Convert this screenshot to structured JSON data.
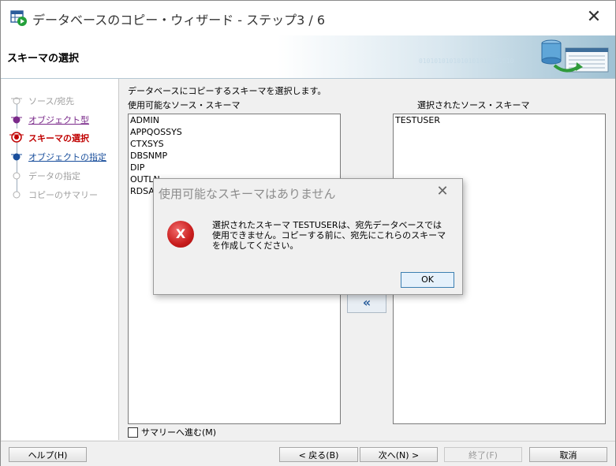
{
  "window": {
    "title": "データベースのコピー・ウィザード - ステップ3 / 6",
    "close_glyph": "✕"
  },
  "header": {
    "title": "スキーマの選択",
    "binary_text": "0101010101010101010101010"
  },
  "steps": [
    {
      "label": "ソース/宛先",
      "state": "disabled"
    },
    {
      "label": "オブジェクト型",
      "state": "visited"
    },
    {
      "label": "スキーマの選択",
      "state": "current"
    },
    {
      "label": "オブジェクトの指定",
      "state": "link"
    },
    {
      "label": "データの指定",
      "state": "disabled"
    },
    {
      "label": "コピーのサマリー",
      "state": "disabled"
    }
  ],
  "main": {
    "instruction": "データベースにコピーするスキーマを選択します。",
    "available_label": "使用可能なソース・スキーマ",
    "selected_label": "選択されたソース・スキーマ",
    "available_items": [
      "ADMIN",
      "APPQOSSYS",
      "CTXSYS",
      "DBSNMP",
      "DIP",
      "OUTLN",
      "RDSA"
    ],
    "selected_items": [
      "TESTUSER"
    ],
    "move_left_glyph": "«",
    "summary_checkbox_label": "サマリーへ進む(M)",
    "summary_checked": false
  },
  "footer": {
    "help": "ヘルプ(H)",
    "back": "< 戻る(B)",
    "next": "次へ(N) >",
    "finish": "終了(F)",
    "cancel": "取消"
  },
  "dialog": {
    "title": "使用可能なスキーマはありません",
    "close_glyph": "✕",
    "error_glyph": "X",
    "message": "選択されたスキーマ TESTUSERは、宛先データベースでは使用できません。コピーする前に、宛先にこれらのスキーマを作成してください。",
    "ok": "OK"
  },
  "colors": {
    "link": "#1a4f9c",
    "visited": "#7a2a8a",
    "current": "#c00000",
    "disabled": "#a0a0a0"
  }
}
